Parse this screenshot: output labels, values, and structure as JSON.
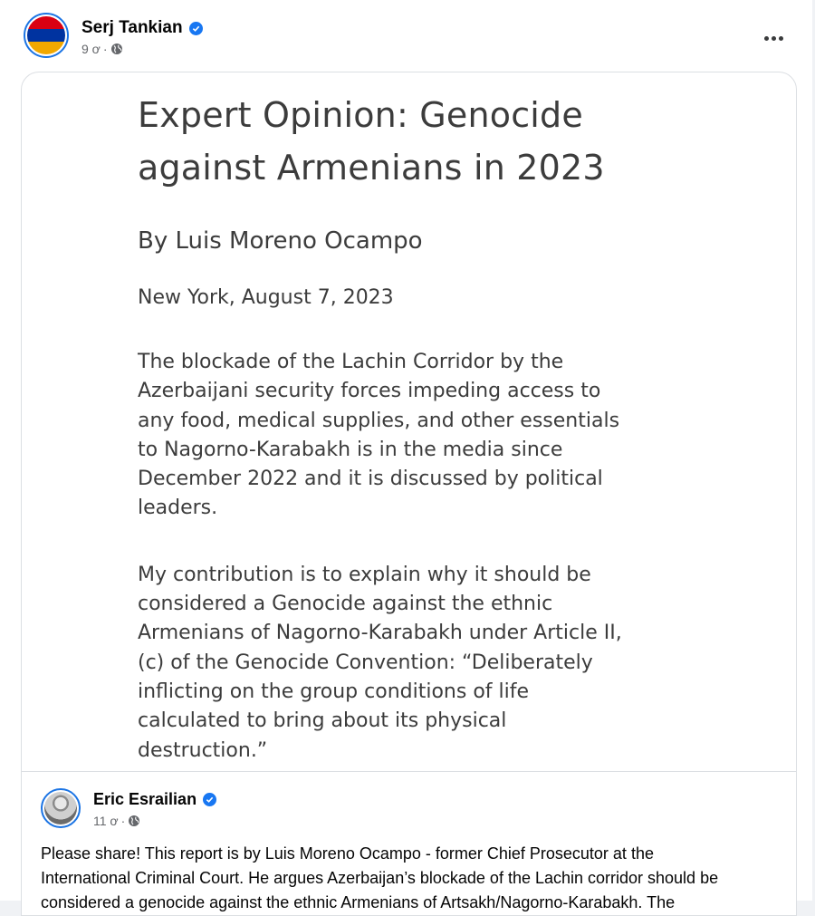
{
  "post": {
    "author": "Serj Tankian",
    "time": "9 ơ",
    "separator": "·",
    "flag_colors": [
      "#d90012",
      "#0033a0",
      "#f2a800"
    ]
  },
  "document": {
    "title_line1": "Expert Opinion: Genocide",
    "title_line2": "against Armenians in 2023",
    "byline": "By Luis Moreno Ocampo",
    "dateline": "New York, August 7, 2023",
    "para1": [
      "The blockade of the Lachin Corridor by the",
      "Azerbaijani security forces impeding access to",
      "any food, medical supplies, and other essentials",
      "to Nagorno-Karabakh is in the media since",
      "December 2022 and it is discussed by political",
      "leaders."
    ],
    "para2": [
      "My contribution is to explain why it should be",
      "considered a Genocide against the ethnic",
      "Armenians of Nagorno-Karabakh under Article II,",
      "(c) of the Genocide Convention: “Deliberately",
      "inflicting on the group conditions of life",
      "calculated to bring about its physical",
      "destruction.”"
    ]
  },
  "quoted": {
    "author": "Eric Esrailian",
    "time": "11 ơ",
    "separator": "·",
    "body_lines": [
      "Please share! This report is by Luis Moreno Ocampo - former Chief Prosecutor at the",
      "International Criminal Court. He argues Azerbaijan’s blockade of the Lachin corridor should be",
      "considered a genocide against the ethnic Armenians of Artsakh/Nagorno-Karabakh. The"
    ]
  },
  "colors": {
    "verified": "#1877f2",
    "ring": "#1b74e4"
  }
}
